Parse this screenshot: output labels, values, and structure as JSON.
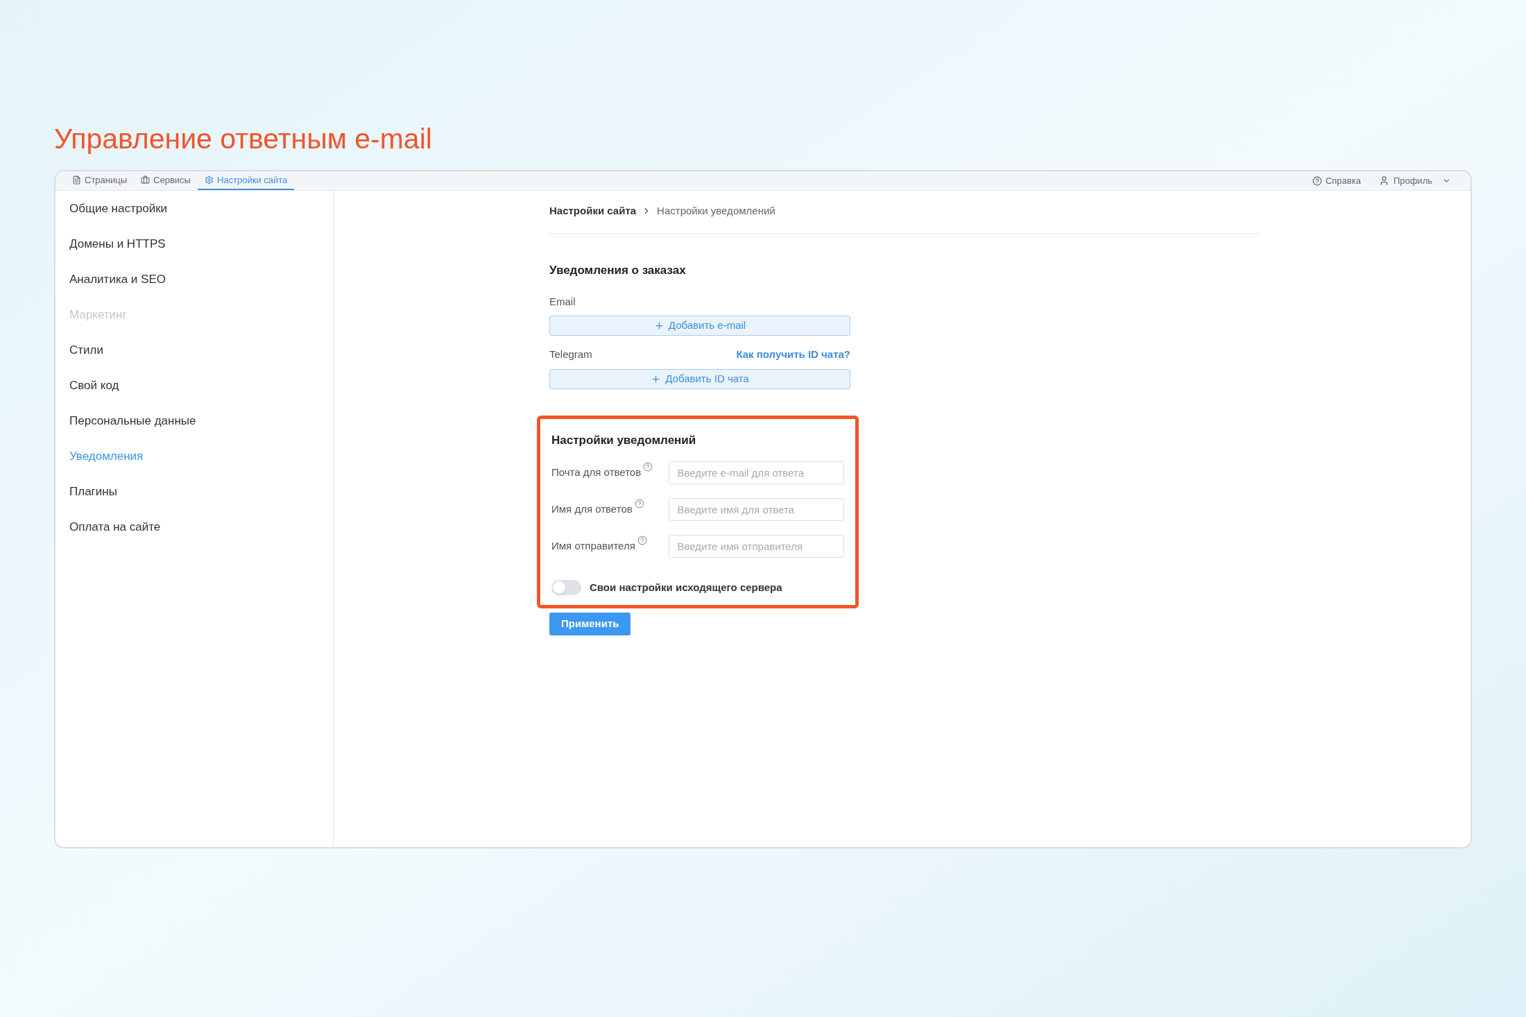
{
  "page_title": "Управление ответным e-mail",
  "tabs": [
    {
      "label": "Страницы",
      "selected": false
    },
    {
      "label": "Сервисы",
      "selected": false
    },
    {
      "label": "Настройки сайта",
      "selected": true
    }
  ],
  "top_right": {
    "help": "Справка",
    "profile": "Профиль"
  },
  "sidebar": {
    "items": [
      {
        "label": "Общие настройки",
        "selected": false,
        "disabled": false
      },
      {
        "label": "Домены и HTTPS",
        "selected": false,
        "disabled": false
      },
      {
        "label": "Аналитика и SEO",
        "selected": false,
        "disabled": false
      },
      {
        "label": "Маркетинг",
        "selected": false,
        "disabled": true
      },
      {
        "label": "Стили",
        "selected": false,
        "disabled": false
      },
      {
        "label": "Свой код",
        "selected": false,
        "disabled": false
      },
      {
        "label": "Персональные данные",
        "selected": false,
        "disabled": false
      },
      {
        "label": "Уведомления",
        "selected": true,
        "disabled": false
      },
      {
        "label": "Плагины",
        "selected": false,
        "disabled": false
      },
      {
        "label": "Оплата на сайте",
        "selected": false,
        "disabled": false
      }
    ]
  },
  "breadcrumb": [
    "Настройки сайта",
    "Настройки уведомлений"
  ],
  "orders": {
    "title": "Уведомления о заказах",
    "email_label": "Email",
    "add_email": "Добавить e-mail",
    "telegram_label": "Telegram",
    "telegram_help": "Как получить ID чата?",
    "add_chat": "Добавить ID чата"
  },
  "settings": {
    "title": "Настройки уведомлений",
    "highlighted": true,
    "fields": [
      {
        "label": "Почта для ответов",
        "placeholder": "Введите e-mail для ответа"
      },
      {
        "label": "Имя для ответов",
        "placeholder": "Введите имя для ответа"
      },
      {
        "label": "Имя отправителя",
        "placeholder": "Введите имя отправителя"
      }
    ],
    "toggle": {
      "label": "Свои настройки исходящего сервера",
      "on": false
    }
  },
  "apply": "Применить"
}
